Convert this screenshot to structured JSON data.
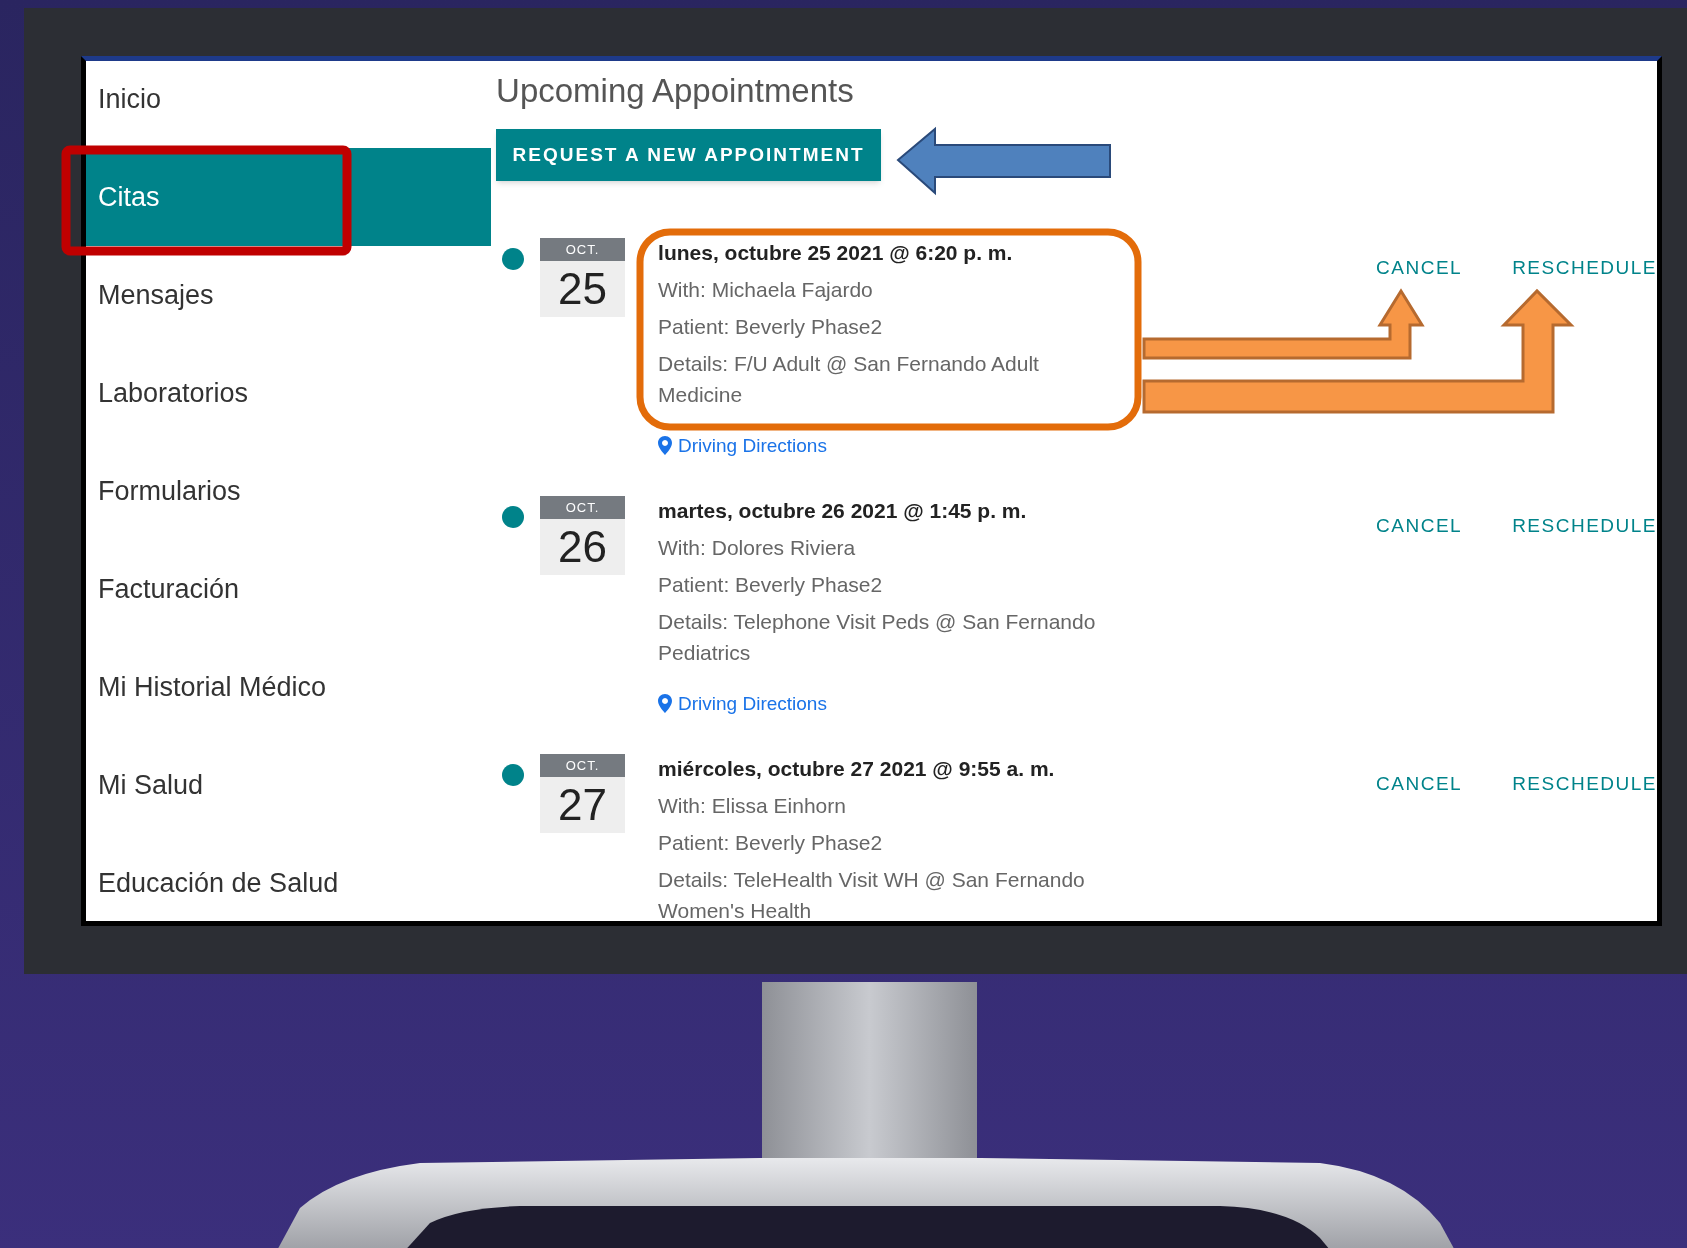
{
  "sidebar": {
    "items": [
      {
        "label": "Inicio",
        "selected": false
      },
      {
        "label": "Citas",
        "selected": true
      },
      {
        "label": "Mensajes",
        "selected": false
      },
      {
        "label": "Laboratorios",
        "selected": false
      },
      {
        "label": "Formularios",
        "selected": false
      },
      {
        "label": "Facturación",
        "selected": false
      },
      {
        "label": "Mi Historial Médico",
        "selected": false
      },
      {
        "label": "Mi Salud",
        "selected": false
      },
      {
        "label": "Educación de Salud",
        "selected": false
      }
    ]
  },
  "main": {
    "title": "Upcoming Appointments",
    "request_button": "REQUEST A NEW APPOINTMENT",
    "appointments": [
      {
        "month": "OCT.",
        "day": "25",
        "datetime": "lunes, octubre 25 2021 @ 6:20 p. m.",
        "with": "With: Michaela Fajardo",
        "patient": "Patient: Beverly Phase2",
        "details": "Details: F/U Adult @ San Fernando Adult Medicine",
        "directions": "Driving Directions",
        "actions": [
          "CANCEL",
          "RESCHEDULE"
        ]
      },
      {
        "month": "OCT.",
        "day": "26",
        "datetime": "martes, octubre 26 2021 @ 1:45 p. m.",
        "with": "With: Dolores Riviera",
        "patient": "Patient: Beverly Phase2",
        "details": "Details: Telephone Visit Peds @ San Fernando Pediatrics",
        "directions": "Driving Directions",
        "actions": [
          "CANCEL",
          "RESCHEDULE"
        ]
      },
      {
        "month": "OCT.",
        "day": "27",
        "datetime": "miércoles, octubre 27 2021 @ 9:55 a. m.",
        "with": "With: Elissa Einhorn",
        "patient": "Patient: Beverly Phase2",
        "details": "Details: TeleHealth Visit WH @ San Fernando Women's Health",
        "actions": [
          "CANCEL",
          "RESCHEDULE"
        ]
      }
    ]
  }
}
